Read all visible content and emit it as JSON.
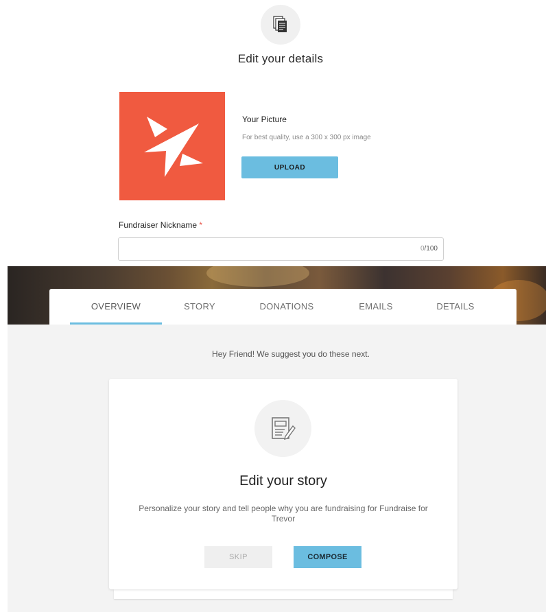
{
  "details": {
    "icon": "documents-icon",
    "title": "Edit your details",
    "picture": {
      "title": "Your Picture",
      "hint": "For best quality, use a 300 x 300 px image",
      "upload_label": "UPLOAD",
      "logo_color": "#f05a40"
    },
    "nickname": {
      "label": "Fundraiser Nickname",
      "required_mark": "*",
      "value": "",
      "counter_current": "0",
      "counter_max": "/100"
    }
  },
  "tabs": [
    {
      "label": "OVERVIEW",
      "active": true
    },
    {
      "label": "STORY",
      "active": false
    },
    {
      "label": "DONATIONS",
      "active": false
    },
    {
      "label": "EMAILS",
      "active": false
    },
    {
      "label": "DETAILS",
      "active": false
    }
  ],
  "overview": {
    "suggestion": "Hey Friend! We suggest you do these next.",
    "card": {
      "icon": "compose-icon",
      "title": "Edit your story",
      "description": "Personalize your story and tell people why you are fundraising for Fundraise for Trevor",
      "skip_label": "SKIP",
      "compose_label": "COMPOSE"
    }
  },
  "colors": {
    "accent": "#6bbde0",
    "required": "#e8564a",
    "background": "#f3f3f3"
  }
}
